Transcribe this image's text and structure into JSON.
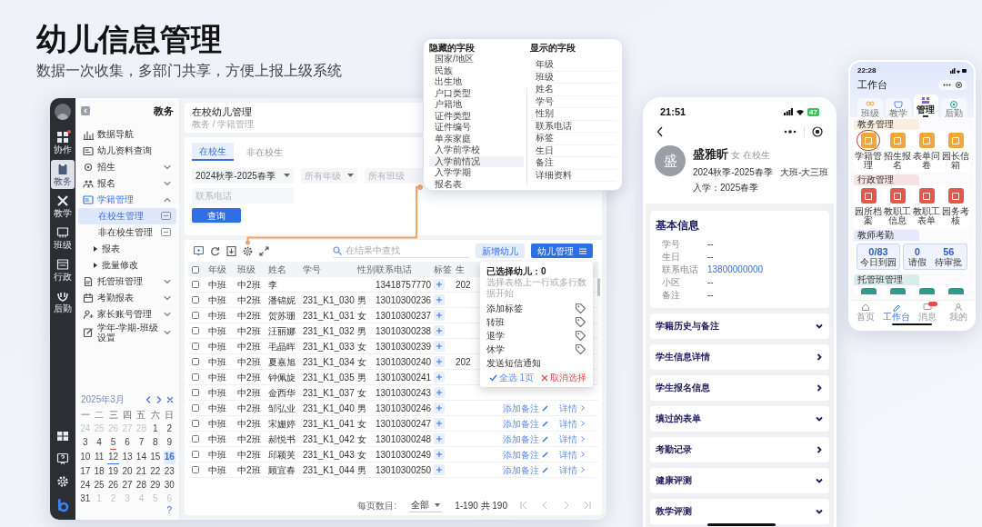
{
  "headline": "幼儿信息管理",
  "subheadline": "数据一次收集，多部门共享，方便上报上级系统",
  "desktop": {
    "rail": {
      "items": [
        {
          "label": "协作",
          "selected": false,
          "badge": true
        },
        {
          "label": "教务",
          "selected": true,
          "badge": false
        },
        {
          "label": "教学",
          "selected": false,
          "badge": false
        },
        {
          "label": "班级",
          "selected": false,
          "badge": false
        },
        {
          "label": "行政",
          "selected": false,
          "badge": false
        },
        {
          "label": "后勤",
          "selected": false,
          "badge": false
        }
      ]
    },
    "sidebar": {
      "title": "教务",
      "items": [
        {
          "label": "数据导航",
          "selected": false
        },
        {
          "label": "幼儿资料查询",
          "selected": false
        },
        {
          "label": "招生",
          "selected": false,
          "expanded": false
        },
        {
          "label": "报名",
          "selected": false,
          "expanded": false
        },
        {
          "label": "学籍管理",
          "selected": false,
          "expanded": true,
          "children": [
            {
              "label": "在校生管理",
              "selected": true
            },
            {
              "label": "非在校生管理",
              "selected": false
            },
            {
              "label": "报表",
              "selected": false,
              "expanded": false
            },
            {
              "label": "批量修改",
              "selected": false,
              "expanded": false
            }
          ]
        },
        {
          "label": "托管班管理",
          "selected": false,
          "expanded": false
        },
        {
          "label": "考勤报表",
          "selected": false,
          "expanded": false
        },
        {
          "label": "家长账号管理",
          "selected": false,
          "expanded": false
        },
        {
          "label": "学年-学期-班级设置",
          "selected": false,
          "expanded": false
        }
      ]
    },
    "calendar": {
      "title": "2025年3月",
      "weekdays": [
        "一",
        "二",
        "三",
        "四",
        "五",
        "六",
        "日"
      ],
      "days": [
        {
          "label": "24",
          "muted": true,
          "selected": false
        },
        {
          "label": "25",
          "muted": true,
          "selected": false
        },
        {
          "label": "26",
          "muted": true,
          "selected": false
        },
        {
          "label": "27",
          "muted": true,
          "selected": false
        },
        {
          "label": "28",
          "muted": true,
          "selected": false
        },
        {
          "label": "1",
          "muted": false,
          "selected": false
        },
        {
          "label": "2",
          "muted": false,
          "selected": false
        },
        {
          "label": "3",
          "muted": false,
          "selected": false
        },
        {
          "label": "4",
          "muted": false,
          "selected": false
        },
        {
          "label": "5",
          "muted": false,
          "selected": false,
          "color": "#e5484d"
        },
        {
          "label": "6",
          "muted": false,
          "selected": false
        },
        {
          "label": "7",
          "muted": false,
          "selected": false
        },
        {
          "label": "8",
          "muted": false,
          "selected": false
        },
        {
          "label": "9",
          "muted": false,
          "selected": false
        },
        {
          "label": "10",
          "muted": false,
          "selected": false
        },
        {
          "label": "11",
          "muted": false,
          "selected": false
        },
        {
          "label": "12",
          "muted": false,
          "selected": false,
          "color": "#3b6fe0"
        },
        {
          "label": "13",
          "muted": false,
          "selected": false
        },
        {
          "label": "14",
          "muted": false,
          "selected": false
        },
        {
          "label": "15",
          "muted": false,
          "selected": false
        },
        {
          "label": "16",
          "muted": false,
          "selected": true
        },
        {
          "label": "17",
          "muted": false,
          "selected": false
        },
        {
          "label": "18",
          "muted": false,
          "selected": false
        },
        {
          "label": "19",
          "muted": false,
          "selected": false
        },
        {
          "label": "20",
          "muted": false,
          "selected": false
        },
        {
          "label": "21",
          "muted": false,
          "selected": false
        },
        {
          "label": "22",
          "muted": false,
          "selected": false
        },
        {
          "label": "23",
          "muted": false,
          "selected": false
        },
        {
          "label": "24",
          "muted": false,
          "selected": false
        },
        {
          "label": "25",
          "muted": false,
          "selected": false
        },
        {
          "label": "26",
          "muted": false,
          "selected": false
        },
        {
          "label": "27",
          "muted": false,
          "selected": false
        },
        {
          "label": "28",
          "muted": false,
          "selected": false
        },
        {
          "label": "29",
          "muted": false,
          "selected": false
        },
        {
          "label": "30",
          "muted": false,
          "selected": false
        },
        {
          "label": "31",
          "muted": false,
          "selected": false
        },
        {
          "label": "1",
          "muted": true,
          "selected": false
        },
        {
          "label": "2",
          "muted": true,
          "selected": false
        },
        {
          "label": "3",
          "muted": true,
          "selected": false
        },
        {
          "label": "4",
          "muted": true,
          "selected": false
        },
        {
          "label": "5",
          "muted": true,
          "selected": false
        },
        {
          "label": "6",
          "muted": true,
          "selected": false
        }
      ],
      "help_glyph": "?"
    },
    "main": {
      "title": "在校幼儿管理",
      "breadcrumb": "教务 / 学籍管理",
      "tabs": [
        {
          "label": "在校生",
          "selected": true
        },
        {
          "label": "非在校生",
          "selected": false
        }
      ],
      "term": "2024秋季-2025春季",
      "grade_placeholder": "所有年级",
      "class_placeholder": "所有班级",
      "phone_placeholder": "联系电话",
      "query_button": "查询",
      "search_placeholder": "在结果中查找",
      "add_button": "新增幼儿",
      "manage_button": "幼儿管理",
      "select_all_checked": false,
      "columns": [
        "年级",
        "班级",
        "姓名",
        "学号",
        "性别",
        "联系电话",
        "标签",
        "生"
      ],
      "rows": [
        {
          "checked": false,
          "grade": "中班",
          "class": "中2班",
          "name": "李",
          "phone": "13418757770",
          "birthday": "202"
        },
        {
          "checked": false,
          "grade": "中班",
          "class": "中2班",
          "name": "潘锦妮",
          "student_id": "231_K1_030",
          "gender": "男",
          "phone": "13010300236"
        },
        {
          "checked": false,
          "grade": "中班",
          "class": "中2班",
          "name": "贺苏珊",
          "student_id": "231_K1_031",
          "gender": "女",
          "phone": "13010300237"
        },
        {
          "checked": false,
          "grade": "中班",
          "class": "中2班",
          "name": "汪丽娜",
          "student_id": "231_K1_032",
          "gender": "男",
          "phone": "13010300238"
        },
        {
          "checked": false,
          "grade": "中班",
          "class": "中2班",
          "name": "毛晶晖",
          "student_id": "231_K1_033",
          "gender": "女",
          "phone": "13010300239"
        },
        {
          "checked": false,
          "grade": "中班",
          "class": "中2班",
          "name": "夏嘉旭",
          "student_id": "231_K1_034",
          "gender": "女",
          "phone": "13010300240",
          "birthday": "202"
        },
        {
          "checked": false,
          "grade": "中班",
          "class": "中2班",
          "name": "钟佩旋",
          "student_id": "231_K1_035",
          "gender": "男",
          "phone": "13010300241"
        },
        {
          "checked": false,
          "grade": "中班",
          "class": "中2班",
          "name": "金西华",
          "student_id": "231_K1_037",
          "gender": "女",
          "phone": "13010300243"
        },
        {
          "checked": false,
          "grade": "中班",
          "class": "中2班",
          "name": "邹弘业",
          "student_id": "231_K1_040",
          "gender": "男",
          "phone": "13010300246",
          "note_action": "添加备注",
          "detail_action": "详情"
        },
        {
          "checked": false,
          "grade": "中班",
          "class": "中2班",
          "name": "宋姗婷",
          "student_id": "231_K1_041",
          "gender": "女",
          "phone": "13010300247",
          "note_action": "添加备注",
          "detail_action": "详情"
        },
        {
          "checked": false,
          "grade": "中班",
          "class": "中2班",
          "name": "郝悦书",
          "student_id": "231_K1_042",
          "gender": "女",
          "phone": "13010300248",
          "note_action": "添加备注",
          "detail_action": "详情"
        },
        {
          "checked": false,
          "grade": "中班",
          "class": "中2班",
          "name": "邱颖芙",
          "student_id": "231_K1_043",
          "gender": "女",
          "phone": "13010300249",
          "note_action": "添加备注",
          "detail_action": "详情"
        },
        {
          "checked": false,
          "grade": "中班",
          "class": "中2班",
          "name": "顾宜春",
          "student_id": "231_K1_044",
          "gender": "男",
          "phone": "13010300250",
          "note_action": "添加备注",
          "detail_action": "详情"
        }
      ],
      "pagination": {
        "label": "每页数目:",
        "page_size": "全部",
        "range": "1-190 共 190"
      },
      "manage_menu": {
        "title": "已选择幼儿：",
        "count": "0",
        "hint": "选择表格上一行或多行数据开始",
        "items": [
          {
            "label": "添加标签",
            "tag": true
          },
          {
            "label": "转班",
            "tag": true
          },
          {
            "label": "退学",
            "tag": true
          },
          {
            "label": "休学",
            "tag": true
          },
          {
            "label": "发送短信通知",
            "tag": false
          }
        ],
        "select_all": "全选 1页",
        "clear": "取消选择"
      }
    }
  },
  "field_picker": {
    "hidden_title": "隐藏的字段",
    "hidden": [
      {
        "label": "国家/地区",
        "selected": false
      },
      {
        "label": "民族",
        "selected": false
      },
      {
        "label": "出生地",
        "selected": false
      },
      {
        "label": "户口类型",
        "selected": false
      },
      {
        "label": "户籍地",
        "selected": false
      },
      {
        "label": "证件类型",
        "selected": false
      },
      {
        "label": "证件编号",
        "selected": false
      },
      {
        "label": "单亲家庭",
        "selected": false
      },
      {
        "label": "入学前学校",
        "selected": false
      },
      {
        "label": "入学前情况",
        "selected": true
      },
      {
        "label": "入学学期",
        "selected": false
      },
      {
        "label": "报名表",
        "selected": false
      }
    ],
    "shown_title": "显示的字段",
    "shown": [
      "年级",
      "班级",
      "姓名",
      "学号",
      "性别",
      "联系电话",
      "标签",
      "生日",
      "备注",
      "详细资料"
    ]
  },
  "phone_detail": {
    "time": "21:51",
    "battery": "47",
    "avatar_char": "盛",
    "name": "盛雅昕",
    "gender": "女",
    "status": "在校生",
    "term_class": "2024秋季-2025春季   大班-大三班",
    "enrolled": "入学：2025春季",
    "basic": {
      "title": "基本信息",
      "fields": [
        {
          "label": "学号",
          "value": "--",
          "link": false
        },
        {
          "label": "生日",
          "value": "--",
          "link": false
        },
        {
          "label": "联系电话",
          "value": "13800000000",
          "link": true
        },
        {
          "label": "小区",
          "value": "--",
          "link": false
        },
        {
          "label": "备注",
          "value": "--",
          "link": false
        }
      ]
    },
    "sections": [
      {
        "label": "学籍历史与备注",
        "kind": "expand"
      },
      {
        "label": "学生信息详情",
        "kind": "navigate"
      },
      {
        "label": "学生报名信息",
        "kind": "navigate"
      },
      {
        "label": "填过的表单",
        "kind": "expand"
      },
      {
        "label": "考勤记录",
        "kind": "navigate"
      },
      {
        "label": "健康评测",
        "kind": "expand"
      },
      {
        "label": "教学评测",
        "kind": "expand"
      }
    ]
  },
  "phone_workbench": {
    "time": "22:28",
    "title": "工作台",
    "tabs": [
      {
        "label": "班级",
        "selected": false
      },
      {
        "label": "教学",
        "selected": false
      },
      {
        "label": "管理",
        "selected": true
      },
      {
        "label": "后勤",
        "selected": false
      }
    ],
    "groups": [
      {
        "title": "教务管理",
        "color": "#f0a63a",
        "apps": [
          {
            "label": "学籍管理",
            "circled": true
          },
          {
            "label": "招生报名",
            "circled": false
          },
          {
            "label": "表单问卷",
            "circled": false
          },
          {
            "label": "园长信箱",
            "circled": false
          }
        ]
      },
      {
        "title": "行政管理",
        "color": "#e0584f",
        "apps": [
          {
            "label": "园所档案",
            "circled": false
          },
          {
            "label": "教职工信息",
            "circled": false
          },
          {
            "label": "教职工表单",
            "circled": false
          },
          {
            "label": "园务考核",
            "circled": false
          }
        ]
      }
    ],
    "attendance": {
      "title": "教师考勤",
      "stats": [
        {
          "value": "0/83",
          "label": "今日到园"
        },
        {
          "value": "0",
          "label": "请假"
        },
        {
          "value": "56",
          "label": "待审批"
        }
      ]
    },
    "partial_group": {
      "title": "托管班管理",
      "color": "#2a9d8f"
    },
    "nav": [
      {
        "label": "首页",
        "selected": false,
        "badge": false
      },
      {
        "label": "工作台",
        "selected": true,
        "badge": false
      },
      {
        "label": "消息",
        "selected": false,
        "badge": true
      },
      {
        "label": "我的",
        "selected": false,
        "badge": false
      }
    ]
  }
}
